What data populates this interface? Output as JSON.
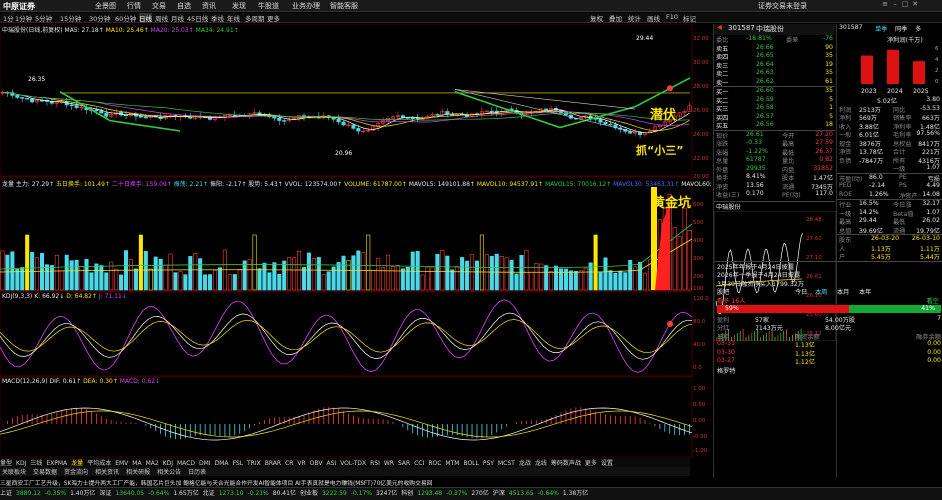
{
  "topbar": {
    "logo": "中原证券",
    "nav": [
      "全景图",
      "行情",
      "交易",
      "自选",
      "资讯",
      "发现",
      "牛股道",
      "业务办理",
      "智能客服"
    ],
    "login": "证券交易未登录"
  },
  "periods": [
    "1分",
    "1分钟",
    "5分钟",
    "15分钟",
    "30分钟",
    "60分钟",
    "日线",
    "周线",
    "月线",
    "45日线",
    "季线",
    "年线",
    "多周期",
    "更多"
  ],
  "tools": [
    "复权",
    "叠加",
    "统计",
    "画线",
    "F10",
    "标记"
  ],
  "main_chart": {
    "legend": {
      "title": "中瑞股份(日线,前复权)",
      "ma5": "MA5: 27.18↑",
      "ma10": "MA10: 25.46↑",
      "ma20": "MA20: 25.03↑",
      "ma34": "MA34: 24.91↑"
    },
    "y_ticks": [
      "32.00",
      "30.00",
      "28.00",
      "26.00",
      "24.00",
      "22.00",
      "20.00"
    ],
    "hi_label": "29.44",
    "lo_label": "20.96",
    "left_label": "26.35",
    "annot1": "潜伏",
    "annot2": "抓“小三”"
  },
  "vol_chart": {
    "legend": [
      "龙量 主力: 27.29↑",
      "五日换手: 101.49↑",
      "二十日换手: 159.09↑",
      "振荡: 2.21↑",
      "振阳: -2.17↑",
      "股势: 5.43↑",
      "VVOL: 123574.00↑",
      "VOLUME: 61787.00↑",
      "MAVOL5: 149101.88↑",
      "MAVOL10: 94537.91↑",
      "MAVOL15: 70016.12↑",
      "MAVOL30: 53463.31↑",
      "MAVOL60: 4"
    ],
    "annot": "黄金坑",
    "y_ticks": [
      "600",
      "500",
      "400",
      "300",
      "200",
      "100"
    ]
  },
  "kdj": {
    "legend": [
      "KDJ(9,3,3)",
      "K: 66.92↓",
      "D: 64.82↑",
      "J: 71.11↓"
    ],
    "y_ticks": [
      "120.0",
      "80.0",
      "40.0",
      "0.0"
    ]
  },
  "macd": {
    "legend": [
      "MACD(12,26,9)",
      "DIF: 0.61↑",
      "DEA: 0.30↑",
      "MACD: 0.62↓"
    ],
    "y_ticks": [
      "1.00",
      "0.50",
      "0.00",
      "-0.50",
      "-1.00"
    ]
  },
  "indicators": [
    "量型",
    "KDJ",
    "三线",
    "EXPMA",
    "龙量",
    "平均成本",
    "EMV",
    "MA",
    "MA2",
    "KDJ",
    "MACD",
    "DMI",
    "DMA",
    "FSL",
    "TRIX",
    "BRAR",
    "CR",
    "VR",
    "OBV",
    "ASI",
    "VOL-TDX",
    "RSI",
    "WR",
    "SAR",
    "CCI",
    "ROC",
    "MTM",
    "BOLL",
    "PSY",
    "MCST",
    "龙战",
    "龙线",
    "筹码数声战",
    "更多",
    "设置"
  ],
  "tabs": [
    "关联板块",
    "交易数据",
    "资金流向",
    "相关资讯",
    "相关研报",
    "相关公告",
    "日历表"
  ],
  "quote": {
    "code": "301587",
    "name": "中瑞股份",
    "wb_label": "委比",
    "wb": "-18.81%",
    "wc_label": "委差",
    "wc": "-76",
    "sells": [
      [
        "卖五",
        "26.66",
        "90"
      ],
      [
        "卖四",
        "26.65",
        "35"
      ],
      [
        "卖三",
        "26.64",
        "19"
      ],
      [
        "卖二",
        "26.63",
        "35"
      ],
      [
        "卖一",
        "26.62",
        "61"
      ]
    ],
    "buys": [
      [
        "买一",
        "26.60",
        "35"
      ],
      [
        "买二",
        "26.59",
        "5"
      ],
      [
        "买三",
        "26.58",
        "1"
      ],
      [
        "买四",
        "26.57",
        "5"
      ],
      [
        "买五",
        "26.56",
        "18"
      ]
    ],
    "stats": [
      [
        "现价",
        "26.61",
        "今开",
        "27.20"
      ],
      [
        "涨跌",
        "-0.33",
        "最高",
        "27.59"
      ],
      [
        "涨幅",
        "-1.22%",
        "最低",
        "26.37"
      ],
      [
        "总量",
        "61787",
        "量比",
        "0.82"
      ],
      [
        "外盘",
        "29935",
        "内盘",
        "31852"
      ],
      [
        "换手",
        "8.41%",
        "股本",
        "1.47亿"
      ],
      [
        "净资",
        "13.56",
        "流通",
        "7345万"
      ],
      [
        "收益(三)",
        "0.170",
        "PE(动)",
        "117.0"
      ]
    ],
    "mini_title": "中瑞股份",
    "mini_ticks": [
      "28.48",
      "27.60",
      "27.10",
      "26.61",
      "26.10",
      "25.60",
      "25.12"
    ],
    "right_ticks": [
      "26.94",
      "26.72",
      "26.50",
      "26.28"
    ],
    "notes": [
      "2025年年报于4月24日披露",
      "2026年一季报于4月24日披露",
      "3月30日融资净买入1799.32万"
    ],
    "tabs": [
      "股吧",
      "今日",
      "本周",
      "本月",
      "本年"
    ],
    "bar_left": "59%",
    "bar_right": "41%",
    "bar_labels": [
      "看多 16人",
      "看空"
    ],
    "fin_bottom": [
      [
        "盈利",
        "57家",
        "54.00万股",
        "7"
      ],
      [
        "分红",
        "7143万元",
        "8.00亿元",
        ""
      ]
    ],
    "rz_header": [
      "日期",
      "融资余额",
      "融券余额"
    ],
    "rz_rows": [
      [
        "03-31",
        "1.13亿",
        "0.00"
      ],
      [
        "03-30",
        "1.13亿",
        "0.00"
      ],
      [
        "03-27",
        "1.12亿",
        "0.00"
      ]
    ],
    "bottom_label": "格罗特"
  },
  "fin": {
    "code": "301587",
    "tabs": [
      "单季",
      "同季",
      "多"
    ],
    "title": "净利润(千万)",
    "years": [
      "2023",
      "2024",
      "2025"
    ],
    "bars": [
      0.75,
      0.9,
      0.6
    ],
    "yaxis": [
      "6",
      "4",
      "2",
      "0"
    ],
    "val": "5.02亿",
    "val2": "3.80",
    "rows": [
      [
        "利润",
        "2513万",
        "同比",
        "-53.53"
      ],
      [
        "净利",
        "569万",
        "销售率",
        "663万"
      ],
      [
        "收入",
        "3.88亿",
        "净利率",
        "1.48亿"
      ],
      [
        "一般",
        "6.01亿",
        "毛利率",
        "97.56%"
      ],
      [
        "现金",
        "3876万",
        "总权益",
        "8417万"
      ],
      [
        "净资",
        "13.78亿",
        "合计",
        "221万"
      ],
      [
        "负债",
        "-7847万",
        "所有",
        "4316万"
      ],
      [
        "",
        "",
        "一级",
        "1.07"
      ]
    ],
    "pe": [
      [
        "市盈(动)",
        "86.0",
        "PE",
        "亏损"
      ],
      [
        "PEG",
        "-2.14",
        "PS",
        "4.49"
      ],
      [
        "ROE",
        "1.26%",
        "净资产",
        "14.08"
      ]
    ],
    "more": [
      [
        "行业",
        "16.5%",
        "今日涨",
        "32.17"
      ],
      [
        "一级",
        "14.2%",
        "Beta值",
        "1.07"
      ],
      [
        "最高",
        "29.44",
        "最低",
        "26.02"
      ],
      [
        "总值",
        "39.69亿",
        "流通",
        "19.79亿"
      ]
    ],
    "dates": [
      [
        "股东",
        "26-03-20",
        "26-03-10"
      ],
      [
        "人",
        "1.13万",
        "1.11万"
      ],
      [
        "户",
        "5.45万",
        "5.44万"
      ]
    ]
  },
  "bottom": {
    "items": [
      "上证",
      "3880.12",
      "-0.35%",
      "1.40万亿",
      "深证",
      "13640.05",
      "-0.64%",
      "1.65万亿",
      "北证",
      "1273.10",
      "-0.21%",
      "80.41亿",
      "创业板",
      "3222.59",
      "-0.17%",
      "3247亿",
      "科创",
      "1293.48",
      "-0.37%",
      "270亿",
      "沪深",
      "4513.65",
      "-0.64%",
      "1.38万亿"
    ],
    "ticker": "三星西安工厂工艺升级，SK海力士提升两大工厂产能，韩国芯片巨头加   鲍格亿能与天合光能合作开发AI智能体项目   AI手表真就是电力赚钱(MSFT)70亿美元的收购交易回"
  }
}
